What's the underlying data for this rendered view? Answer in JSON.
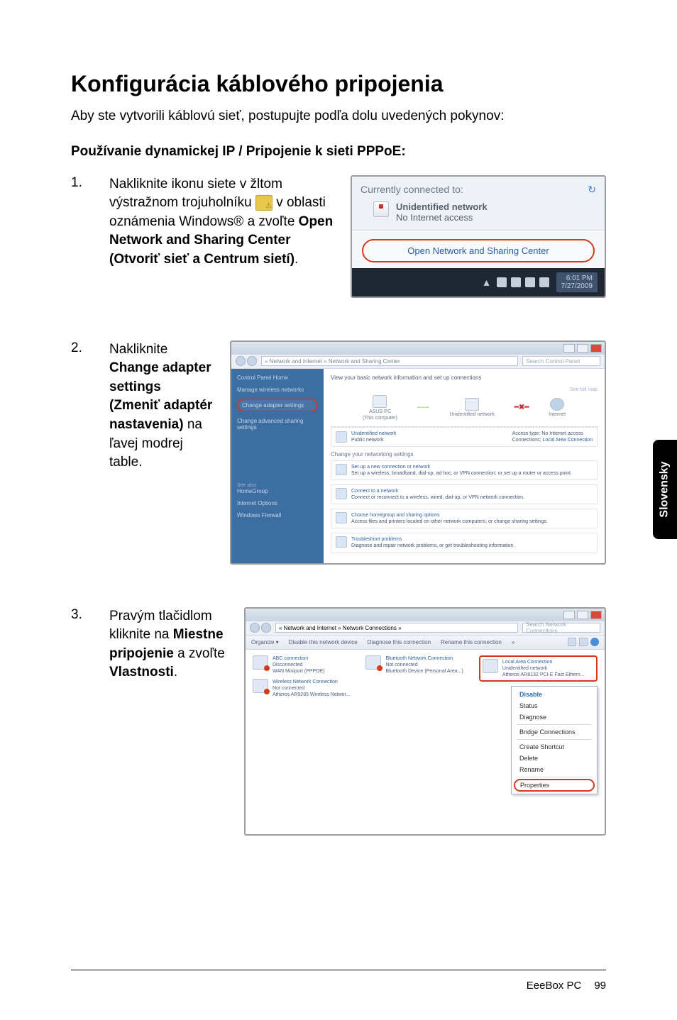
{
  "side_tab": "Slovensky",
  "title": "Konfigurácia káblového pripojenia",
  "intro": "Aby ste vytvorili káblovú sieť, postupujte podľa dolu uvedených pokynov:",
  "section_title": "Používanie dynamickej IP / Pripojenie k sieti PPPoE:",
  "steps": {
    "s1": {
      "num": "1.",
      "t1": "Nakliknite ikonu siete v žltom výstražnom trojuholníku ",
      "t2": " v oblasti oznámenia Windows® a zvoľte ",
      "bold": "Open Network and Sharing Center (Otvoriť sieť a Centrum sietí)",
      "t3": "."
    },
    "s2": {
      "num": "2.",
      "t1": "Nakliknite ",
      "bold": "Change adapter settings (Zmeniť adaptér nastavenia)",
      "t2": " na ľavej modrej table."
    },
    "s3": {
      "num": "3.",
      "t1": "Pravým tlačidlom kliknite na ",
      "bold1": "Miestne pripojenie",
      "t2": " a zvoľte ",
      "bold2": "Vlastnosti",
      "t3": "."
    }
  },
  "illus_a": {
    "currently": "Currently connected to:",
    "unidentified": "Unidentified network",
    "no_access": "No Internet access",
    "open_center": "Open Network and Sharing Center",
    "icons": [
      "flag-icon",
      "action-center-icon",
      "network-icon",
      "volume-icon"
    ],
    "time": "6:01 PM",
    "date": "7/27/2009"
  },
  "illus_b": {
    "addr": "« Network and Internet » Network and Sharing Center",
    "search_placeholder": "Search Control Panel",
    "side_items": [
      "Control Panel Home",
      "Manage wireless networks",
      "Change adapter settings",
      "Change advanced sharing settings"
    ],
    "main_title": "View your basic network information and set up connections",
    "nodes": {
      "pc": "ASUS-PC",
      "pc_sub": "(This computer)",
      "net": "Unidentified network",
      "inet": "Internet"
    },
    "see_full_map": "See full map",
    "active_net": {
      "name": "Unidentified network",
      "type": "Public network",
      "access": "Access type:",
      "access_v": "No Internet access",
      "conn": "Connections:",
      "conn_v": "Local Area Connection"
    },
    "change_sec": "Change your networking settings",
    "tiles": [
      {
        "h": "Set up a new connection or network",
        "d": "Set up a wireless, broadband, dial-up, ad hoc, or VPN connection; or set up a router or access point."
      },
      {
        "h": "Connect to a network",
        "d": "Connect or reconnect to a wireless, wired, dial-up, or VPN network connection."
      },
      {
        "h": "Choose homegroup and sharing options",
        "d": "Access files and printers located on other network computers, or change sharing settings."
      },
      {
        "h": "Troubleshoot problems",
        "d": "Diagnose and repair network problems, or get troubleshooting information."
      }
    ],
    "see_also": [
      "See also",
      "HomeGroup",
      "Internet Options",
      "Windows Firewall"
    ]
  },
  "illus_c": {
    "addr": "« Network and Internet » Network Connections »",
    "search_placeholder": "Search Network Connections",
    "toolbar": [
      "Organize ▾",
      "Disable this network device",
      "Diagnose this connection",
      "Rename this connection",
      "»"
    ],
    "connections": [
      {
        "name": "ABC connection",
        "sub": "Disconnected",
        "sub2": "WAN Miniport (PPPOE)"
      },
      {
        "name": "Bluetooth Network Connection",
        "sub": "Not connected",
        "sub2": "Bluetooth Device (Personal Area...)"
      },
      {
        "name": "Local Area Connection",
        "sub": "Unidentified network",
        "sub2": "Atheros AR8132 PCI-E Fast Ethern..."
      },
      {
        "name": "Wireless Network Connection",
        "sub": "Not connected",
        "sub2": "Atheros AR9285 Wireless Networ..."
      }
    ],
    "ctx": [
      "Disable",
      "Status",
      "Diagnose",
      "Bridge Connections",
      "Create Shortcut",
      "Delete",
      "Rename",
      "Properties"
    ]
  },
  "footer": {
    "product": "EeeBox PC",
    "page": "99"
  }
}
